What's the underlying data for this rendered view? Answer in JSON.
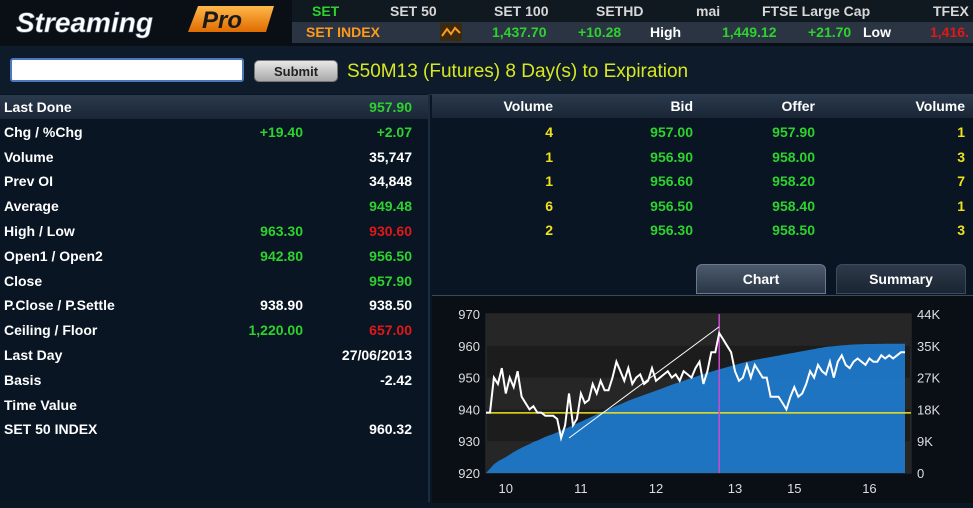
{
  "colors": {
    "yellow": "#f0e21a",
    "green": "#2ed22e",
    "red": "#e01818",
    "white": "#ffffff",
    "orange": "#ff9a1a",
    "headline": "#d8e820"
  },
  "logo": {
    "text1": "Streaming",
    "text2": "Pro"
  },
  "ticker": {
    "tabs": [
      "SET",
      "SET 50",
      "SET 100",
      "SETHD",
      "mai",
      "FTSE Large Cap",
      "TFEX"
    ],
    "index_name": "SET INDEX",
    "last": "1,437.70",
    "change": "+10.28",
    "high_label": "High",
    "high": "1,449.12",
    "high_change": "+21.70",
    "low_label": "Low",
    "low": "1,416."
  },
  "search": {
    "value": "",
    "placeholder": ""
  },
  "submit_label": "Submit",
  "headline": "S50M13 (Futures) 8 Day(s) to Expiration",
  "quote_rows": [
    {
      "label": "Last Done",
      "v1": "",
      "v2": "957.90",
      "c1": "white",
      "c2": "green"
    },
    {
      "label": "Chg / %Chg",
      "v1": "+19.40",
      "v2": "+2.07",
      "c1": "green",
      "c2": "green"
    },
    {
      "label": "Volume",
      "v1": "",
      "v2": "35,747",
      "c1": "white",
      "c2": "white"
    },
    {
      "label": "Prev OI",
      "v1": "",
      "v2": "34,848",
      "c1": "white",
      "c2": "white"
    },
    {
      "label": "Average",
      "v1": "",
      "v2": "949.48",
      "c1": "white",
      "c2": "green"
    },
    {
      "label": "High / Low",
      "v1": "963.30",
      "v2": "930.60",
      "c1": "green",
      "c2": "red"
    },
    {
      "label": "Open1 / Open2",
      "v1": "942.80",
      "v2": "956.50",
      "c1": "green",
      "c2": "green"
    },
    {
      "label": "Close",
      "v1": "",
      "v2": "957.90",
      "c1": "white",
      "c2": "green"
    },
    {
      "label": "P.Close / P.Settle",
      "v1": "938.90",
      "v2": "938.50",
      "c1": "white",
      "c2": "white"
    },
    {
      "label": "Ceiling / Floor",
      "v1": "1,220.00",
      "v2": "657.00",
      "c1": "green",
      "c2": "red"
    },
    {
      "label": "Last Day",
      "v1": "",
      "v2": "27/06/2013",
      "c1": "white",
      "c2": "white"
    },
    {
      "label": "Basis",
      "v1": "",
      "v2": "-2.42",
      "c1": "white",
      "c2": "white"
    },
    {
      "label": "Time Value",
      "v1": "",
      "v2": "",
      "c1": "white",
      "c2": "white"
    },
    {
      "label": "SET 50 INDEX",
      "v1": "",
      "v2": "960.32",
      "c1": "white",
      "c2": "white"
    }
  ],
  "orderbook": {
    "headers": [
      "Volume",
      "Bid",
      "Offer",
      "Volume"
    ],
    "rows": [
      [
        "4",
        "957.00",
        "957.90",
        "1"
      ],
      [
        "1",
        "956.90",
        "958.00",
        "3"
      ],
      [
        "1",
        "956.60",
        "958.20",
        "7"
      ],
      [
        "6",
        "956.50",
        "958.40",
        "1"
      ],
      [
        "2",
        "956.30",
        "958.50",
        "3"
      ]
    ]
  },
  "tabs": {
    "chart": "Chart",
    "summary": "Summary"
  },
  "chart_data": {
    "type": "line",
    "y_left_ticks": [
      "970",
      "960",
      "950",
      "940",
      "930",
      "920"
    ],
    "y_right_ticks": [
      "44K",
      "35K",
      "27K",
      "18K",
      "9K",
      "0"
    ],
    "x_ticks": [
      "10",
      "11",
      "12",
      "13",
      "15",
      "16"
    ],
    "ylim": [
      920,
      970
    ],
    "y2lim": [
      0,
      44000
    ],
    "price": [
      939,
      939,
      950,
      948,
      953,
      945,
      950,
      947,
      952,
      944,
      942,
      940,
      941,
      939,
      939,
      938,
      938,
      938,
      937,
      931,
      935,
      945,
      935,
      937,
      945,
      942,
      943,
      948,
      945,
      949,
      946,
      946,
      950,
      955,
      952,
      949,
      953,
      948,
      950,
      951,
      948,
      949,
      953,
      949,
      950,
      951,
      952,
      950,
      951,
      949,
      952,
      951,
      950,
      953,
      955,
      948,
      952,
      958,
      958,
      964,
      962,
      960,
      958,
      952,
      949,
      950,
      954,
      950,
      954,
      952,
      950,
      950,
      944,
      944,
      944,
      942,
      940,
      944,
      947,
      944,
      945,
      948,
      952,
      950,
      954,
      952,
      951,
      955,
      950,
      955,
      957,
      954,
      953,
      955,
      956,
      955,
      954,
      956,
      955,
      955,
      957,
      956,
      957,
      956,
      957,
      958,
      958
    ],
    "volume": [
      0,
      1200,
      2400,
      3200,
      3800,
      4400,
      5100,
      5800,
      6400,
      7000,
      7500,
      8000,
      8600,
      9000,
      9500,
      10000,
      10400,
      10800,
      11300,
      11800,
      12200,
      12700,
      13200,
      13700,
      14200,
      14700,
      15200,
      15700,
      16200,
      16700,
      17200,
      17600,
      18100,
      18600,
      19000,
      19500,
      20000,
      20400,
      20800,
      21200,
      21600,
      22000,
      22400,
      22800,
      23200,
      23600,
      24000,
      24400,
      24800,
      25100,
      25500,
      25900,
      26300,
      26600,
      27000,
      27300,
      27700,
      28000,
      28400,
      28700,
      29000,
      29300,
      29600,
      29900,
      30200,
      30500,
      30800,
      31000,
      31300,
      31500,
      31700,
      31900,
      32100,
      32300,
      32500,
      32700,
      32900,
      33100,
      33300,
      33500,
      33700,
      33900,
      34100,
      34300,
      34500,
      34700,
      34900,
      35000,
      35100,
      35200,
      35300,
      35400,
      35500,
      35550,
      35600,
      35650,
      35700,
      35700,
      35710,
      35720,
      35730,
      35740,
      35745,
      35747,
      35747,
      35747,
      35747
    ],
    "prev_close": 938.9,
    "marker_index": 59,
    "trendline": [
      [
        21,
        931
      ],
      [
        59,
        966
      ]
    ],
    "colors": {
      "price": "#ffffff",
      "volume": "#1e78c8",
      "prev_close": "#f0e21a",
      "marker": "#c84ccf"
    }
  }
}
